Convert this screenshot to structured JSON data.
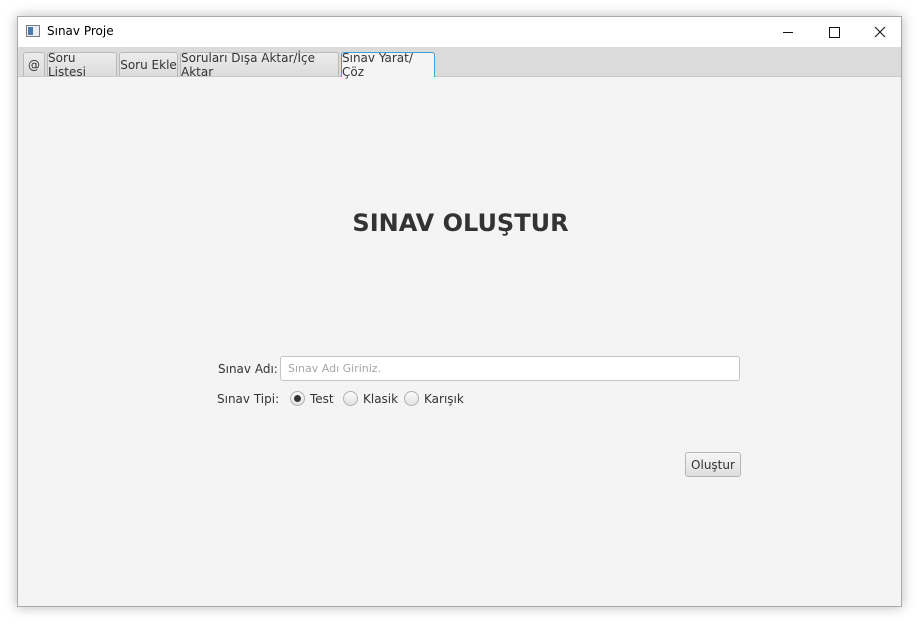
{
  "window": {
    "title": "Sınav Proje",
    "controls": {
      "minimize": "minimize-icon",
      "maximize": "maximize-icon",
      "close": "close-icon"
    }
  },
  "tabs": [
    {
      "label": "@"
    },
    {
      "label": "Soru Listesi"
    },
    {
      "label": "Soru Ekle"
    },
    {
      "label": "Soruları Dışa Aktar/İçe Aktar"
    },
    {
      "label": "Sınav Yarat/Çöz",
      "active": true
    }
  ],
  "main": {
    "heading": "SINAV OLUŞTUR",
    "exam_name_label": "Sınav Adı:",
    "exam_name_value": "",
    "exam_name_placeholder": "Sınav Adı Giriniz.",
    "exam_type_label": "Sınav Tipi:",
    "exam_type_options": [
      {
        "label": "Test",
        "selected": true
      },
      {
        "label": "Klasik",
        "selected": false
      },
      {
        "label": "Karışık",
        "selected": false
      }
    ],
    "create_button": "Oluştur"
  },
  "colors": {
    "active_tab_border": "#3f9fd8",
    "background": "#f4f4f4"
  }
}
